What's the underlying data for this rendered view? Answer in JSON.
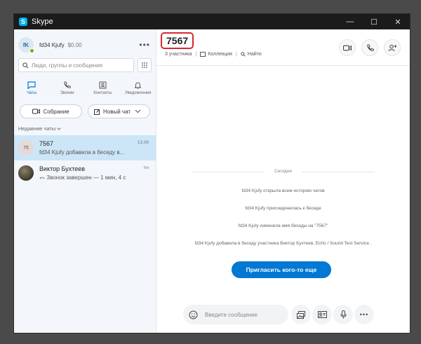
{
  "window": {
    "title": "Skype",
    "app_icon": "S"
  },
  "profile": {
    "initials": "fK",
    "name": "fd34 Kjufy",
    "balance": "$0.00"
  },
  "search": {
    "placeholder": "Люди, группы и сообщения"
  },
  "nav": [
    {
      "label": "Чаты",
      "icon": "chat-icon",
      "active": true
    },
    {
      "label": "Звонки",
      "icon": "phone-icon"
    },
    {
      "label": "Контакты",
      "icon": "contacts-icon"
    },
    {
      "label": "Уведомления",
      "icon": "bell-icon"
    }
  ],
  "actions": {
    "meeting": "Собрание",
    "new_chat": "Новый чат"
  },
  "recent_label": "Недавние чаты",
  "chats": [
    {
      "initials": "75",
      "name": "7567",
      "preview": "fd34 Kjufy добавила в беседу в...",
      "time": "13.08"
    },
    {
      "name": "Виктор Бухтеев",
      "preview": "Звонок завершен — 1 мин, 4 с",
      "time": "пн"
    }
  ],
  "conversation": {
    "title": "7567",
    "participants": "3 участника",
    "collection": "Коллекция",
    "find": "Найти",
    "date": "Сегодня",
    "events": [
      "fd34 Kjufy открыла всем историю чатов",
      "fd34 Kjufy присоединилась к беседе",
      "fd34 Kjufy изменила имя беседы на \"7567\"",
      "fd34 Kjufy добавила в беседу участника Виктор Бухтеев, Echo / Sound Test Service ."
    ],
    "invite_label": "Пригласить кого-то еще",
    "composer_placeholder": "Введите сообщение"
  },
  "colors": {
    "accent": "#0078d4",
    "highlight": "#d9262f",
    "online": "#6bb700",
    "titlebar": "#1b1b1b"
  }
}
